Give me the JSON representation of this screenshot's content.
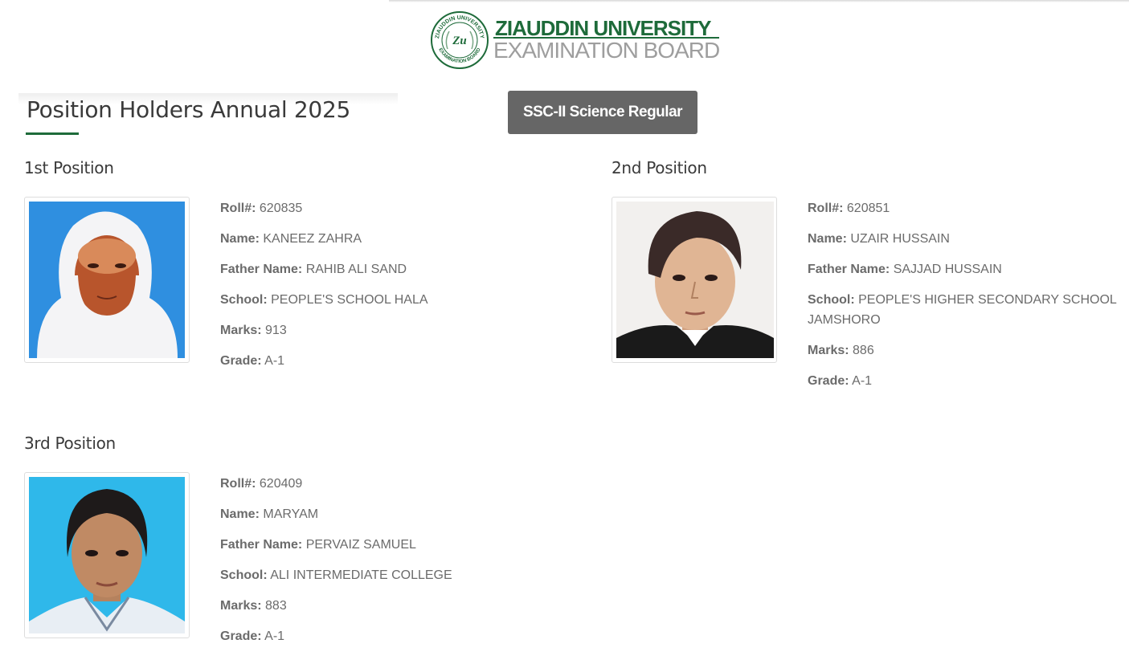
{
  "header": {
    "brand_top": "ZIAUDDIN UNIVERSITY",
    "brand_bottom": "EXAMINATION BOARD",
    "seal_ring_top": "ZIAUDDIN UNIVERSITY",
    "seal_ring_bottom": "EXAMINATION BOARD",
    "seal_monogram": "Zu",
    "brand_color": "#1e6b3a"
  },
  "page": {
    "title": "Position Holders Annual 2025",
    "category_button": "SSC-II Science Regular"
  },
  "field_labels": {
    "roll": "Roll#:",
    "name": "Name:",
    "father": "Father Name:",
    "school": "School:",
    "marks": "Marks:",
    "grade": "Grade:"
  },
  "positions": [
    {
      "heading": "1st Position",
      "roll": "620835",
      "name": "KANEEZ ZAHRA",
      "father": "RAHIB ALI SAND",
      "school": "PEOPLE'S SCHOOL HALA",
      "marks": "913",
      "grade": "A-1",
      "photo_background": "#2f8fe0"
    },
    {
      "heading": "2nd Position",
      "roll": "620851",
      "name": "UZAIR HUSSAIN",
      "father": "SAJJAD HUSSAIN",
      "school": "PEOPLE'S HIGHER SECONDARY SCHOOL JAMSHORO",
      "marks": "886",
      "grade": "A-1",
      "photo_background": "#f2f0ee"
    },
    {
      "heading": "3rd Position",
      "roll": "620409",
      "name": "MARYAM",
      "father": "PERVAIZ SAMUEL",
      "school": "ALI INTERMEDIATE COLLEGE",
      "marks": "883",
      "grade": "A-1",
      "photo_background": "#2fb8ea"
    }
  ]
}
